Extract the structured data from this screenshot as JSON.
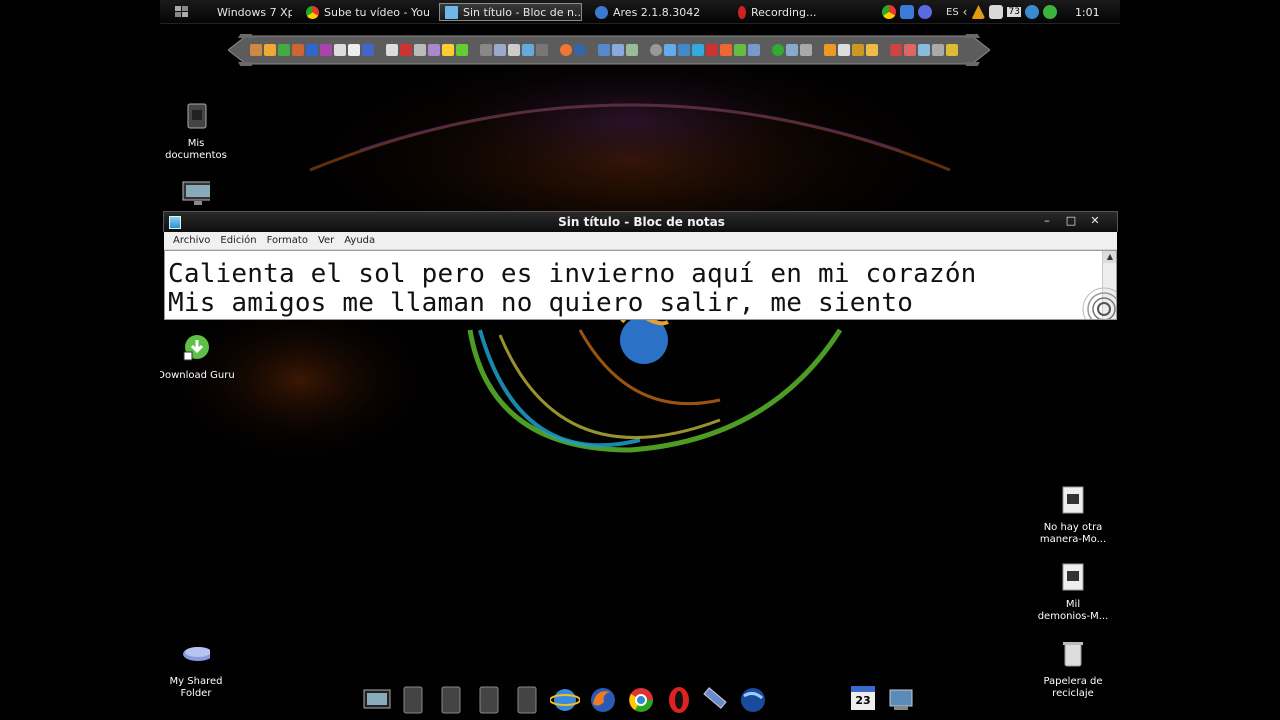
{
  "taskbar": {
    "start_label": "",
    "tasks": [
      {
        "label": "Windows 7 Xp"
      },
      {
        "label": "Sube tu vídeo - You..."
      },
      {
        "label": "Sin título - Bloc de n..."
      },
      {
        "label": "Ares 2.1.8.3042"
      },
      {
        "label": "Recording..."
      }
    ],
    "language": "ES",
    "tray_badge": "73",
    "clock": "1:01"
  },
  "desktop_icons": {
    "mis_documentos": {
      "line1": "Mis",
      "line2": "documentos"
    },
    "download_guru": {
      "line1": "Download Guru"
    },
    "no_hay_otra": {
      "line1": "No hay otra",
      "line2": "manera-Mo..."
    },
    "mil_demonios": {
      "line1": "Mil",
      "line2": "demonios-M..."
    },
    "papelera": {
      "line1": "Papelera de",
      "line2": "reciclaje"
    },
    "shared_folder": {
      "line1": "My Shared",
      "line2": "Folder"
    }
  },
  "notepad": {
    "title": "Sin título - Bloc de notas",
    "menu": [
      "Archivo",
      "Edición",
      "Formato",
      "Ver",
      "Ayuda"
    ],
    "lines": [
      "Calienta el sol pero es invierno aquí en mi corazón",
      "Mis amigos me llaman no quiero salir, me siento"
    ]
  },
  "dock": {
    "calendar_day": "23"
  },
  "colors": {
    "notepad_bg": "#ffffff",
    "menu_bg": "#f0f0f0",
    "desktop_bg": "#020101"
  }
}
